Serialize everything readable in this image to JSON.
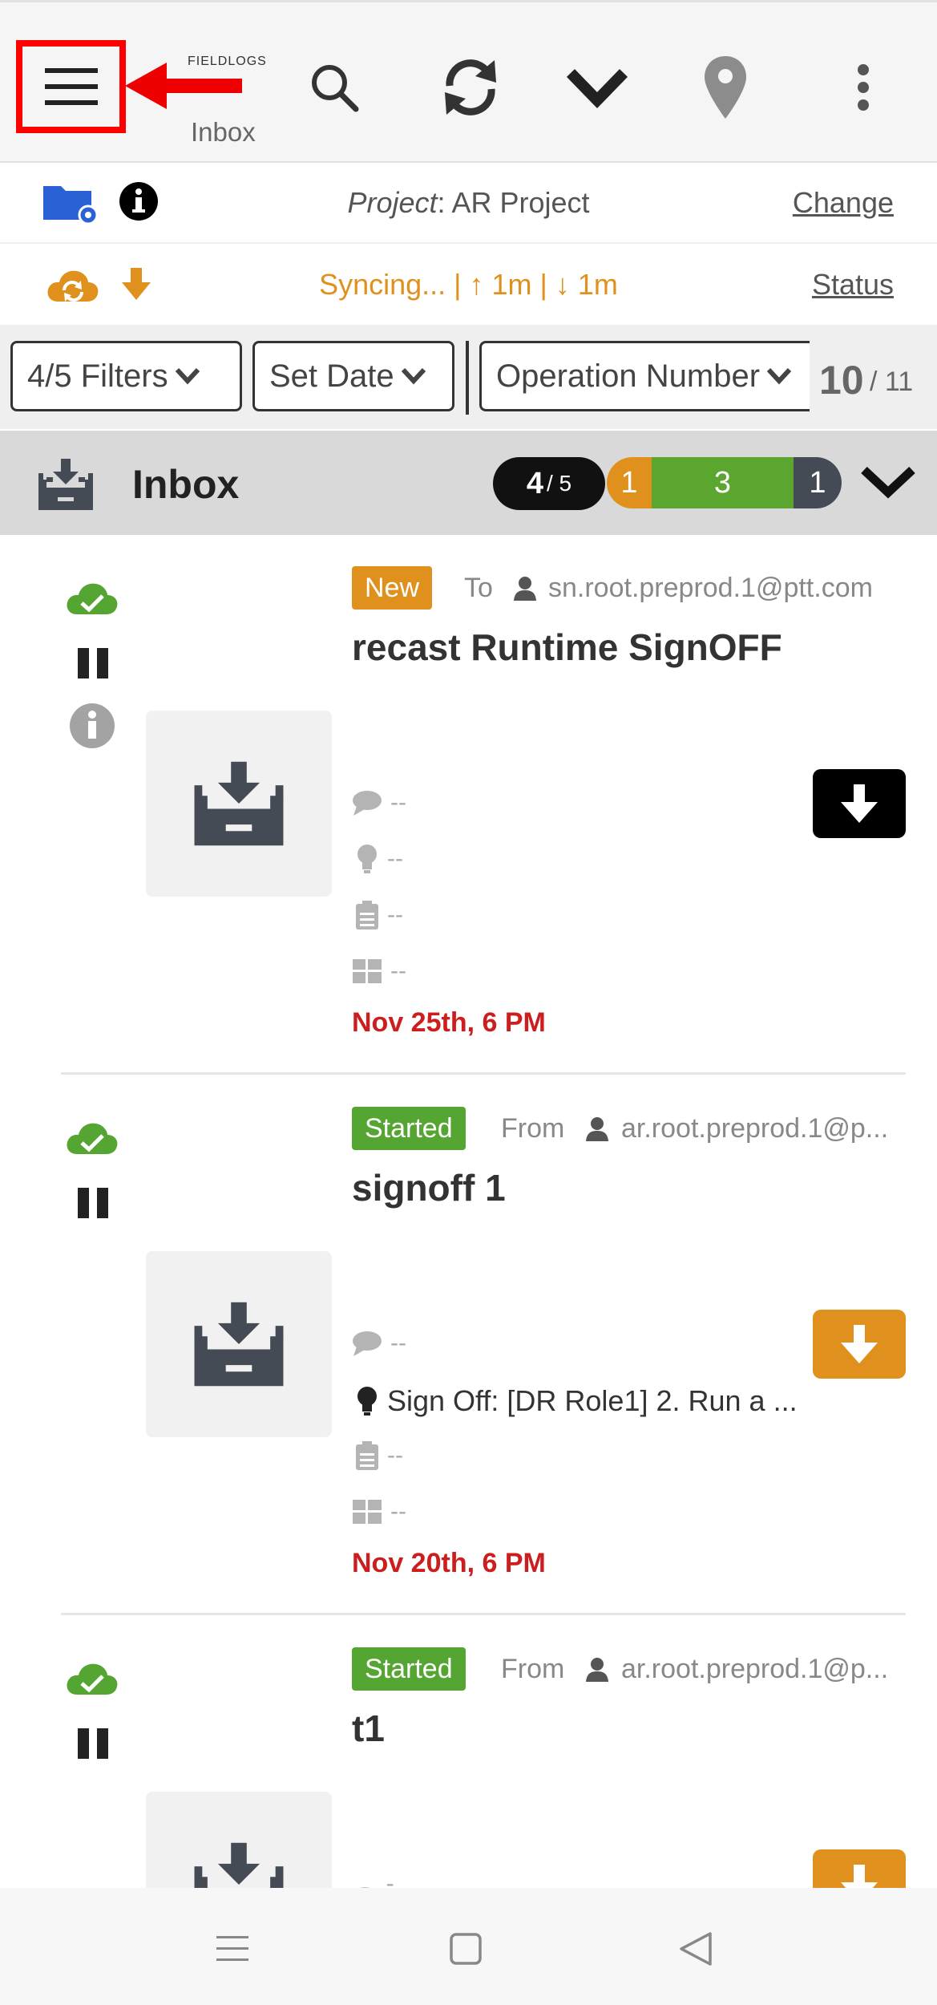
{
  "toolbar": {
    "brand": "FIELDLOGS",
    "title": "Inbox"
  },
  "project": {
    "label": "Project",
    "name": ": AR Project",
    "change": "Change"
  },
  "sync": {
    "text": "Syncing... | ↑ 1m | ↓ 1m",
    "status": "Status"
  },
  "filters": {
    "filters_label": "4/5 Filters",
    "date_label": "Set Date",
    "sort_label": "Operation Number",
    "count_main": "10",
    "count_total": "/ 11"
  },
  "inbox": {
    "title": "Inbox",
    "page_current": "4",
    "page_total": "/ 5",
    "status_counts": [
      "1",
      "3",
      "1"
    ]
  },
  "cards": [
    {
      "tag": "New",
      "tag_color": "#e0901c",
      "direction": "To",
      "user": "sn.root.preprod.1@ptt.com",
      "title": "recast Runtime SignOFF",
      "comment": "--",
      "idea": "--",
      "task": "--",
      "grid": "--",
      "date": "Nov 25th, 6 PM",
      "button_color": "#000000"
    },
    {
      "tag": "Started",
      "tag_color": "#55a532",
      "direction": "From",
      "user": "ar.root.preprod.1@p...",
      "title": "signoff 1",
      "comment": "--",
      "idea": "Sign Off: [DR Role1] 2. Run a ...",
      "task": "--",
      "grid": "--",
      "date": "Nov 20th, 6 PM",
      "button_color": "#e0901c"
    },
    {
      "tag": "Started",
      "tag_color": "#55a532",
      "direction": "From",
      "user": "ar.root.preprod.1@p...",
      "title": "t1",
      "comment": "--",
      "button_color": "#e0901c"
    }
  ],
  "colors": {
    "orange": "#e0901c",
    "green": "#55a532",
    "dark": "#444b54",
    "red_annotation": "#ff0000",
    "date_red": "#cc1e1e"
  }
}
